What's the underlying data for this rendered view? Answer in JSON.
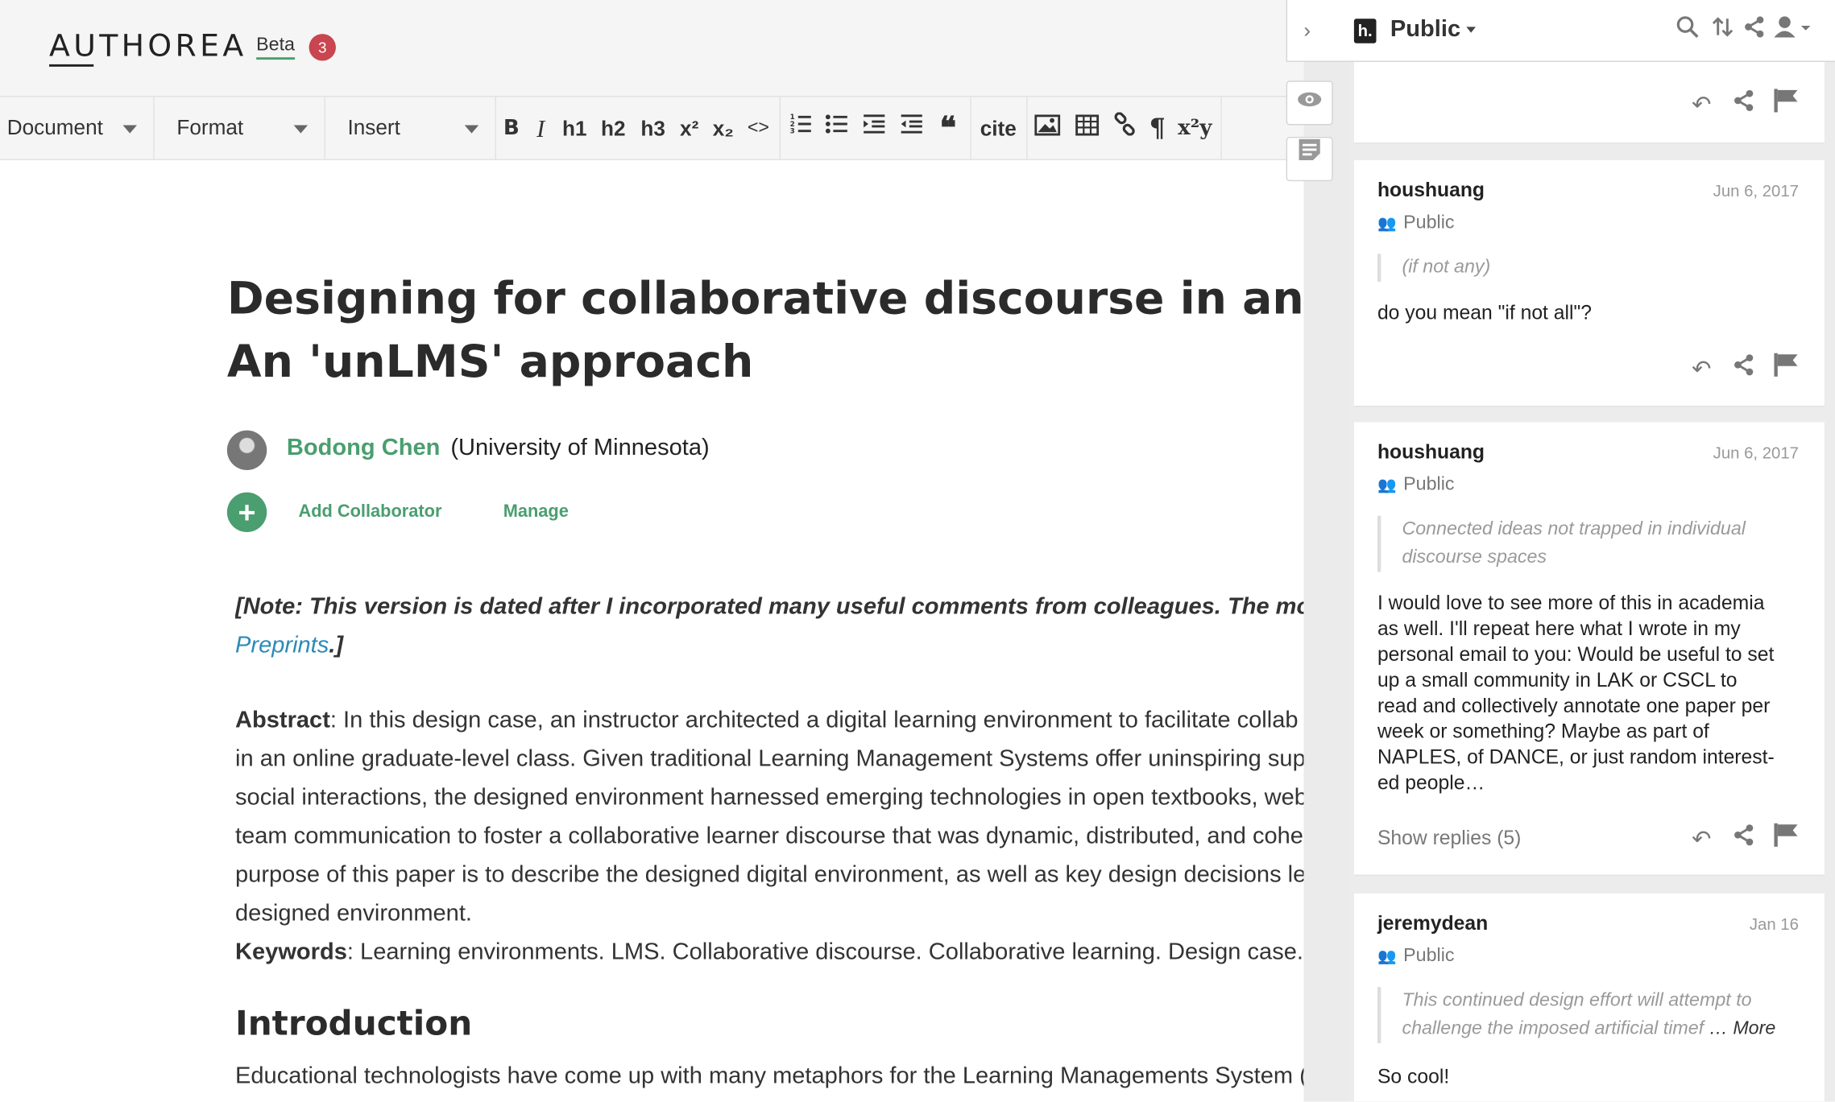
{
  "app": {
    "logo": "AUTHOREA",
    "beta": "Beta",
    "badge": "3"
  },
  "toolbar": {
    "menus": [
      "Document",
      "Format",
      "Insert"
    ],
    "buttons": [
      "B",
      "I",
      "h1",
      "h2",
      "h3",
      "x²",
      "x₂",
      "<>",
      "ordered-list",
      "bullet-list",
      "indent",
      "outdent",
      "quote",
      "cite",
      "image",
      "table",
      "link",
      "pilcrow",
      "x²y"
    ]
  },
  "document": {
    "title_line1": "Designing for collaborative discourse in an online",
    "title_line2": "An 'unLMS' approach",
    "author": "Bodong Chen",
    "affiliation": "(University of Minnesota)",
    "add_collaborator": "Add Collaborator",
    "manage": "Manage",
    "note_text": "[Note: This version is dated after I incorporated many useful comments from colleagues. The most recent v",
    "note_link": "Preprints",
    "note_end": ".]",
    "abstract_label": "Abstract",
    "abstract_lines": [
      ": In this design case, an instructor architected a digital learning environment to facilitate collab",
      "in an online graduate-level class. Given traditional Learning Management Systems offer uninspiring sup",
      "social interactions, the designed environment harnessed emerging technologies in open textbooks, web",
      "team communication to foster a collaborative learner discourse that was dynamic, distributed, and cohe",
      "purpose of this paper is to describe the designed digital environment, as well as key design decisions lea",
      "designed environment."
    ],
    "keywords_label": "Keywords",
    "keywords_text": ": Learning environments. LMS. Collaborative discourse. Collaborative learning. Design case.",
    "intro_heading": "Introduction",
    "intro_text": "Educational technologists have come up with many metaphors for the Learning Managements System ("
  },
  "hypothesis": {
    "group": "Public",
    "annotations": [
      {
        "user": "houshuang",
        "date": "Jun 6, 2017",
        "visibility": "Public",
        "quote": "(if not any)",
        "text": "do you mean \"if not all\"?"
      },
      {
        "user": "houshuang",
        "date": "Jun 6, 2017",
        "visibility": "Public",
        "quote_lines": [
          "Connected ideas not trapped in individual",
          "discourse spaces"
        ],
        "text_lines": [
          "I would love to see more of this in academia",
          "as well. I'll repeat here what I wrote in my",
          "personal email to you: Would be useful to set",
          "up a small community in LAK or CSCL to",
          "read and collectively annotate one paper per",
          "week or something? Maybe as part of",
          "NAPLES, of DANCE, or just random interest-",
          "ed people…"
        ],
        "show_replies": "Show replies (5)"
      },
      {
        "user": "jeremydean",
        "date": "Jan 16",
        "visibility": "Public",
        "quote_lines": [
          "This continued design effort will attempt to",
          "challenge the imposed artificial timef"
        ],
        "more": "… More",
        "text": "So cool!"
      }
    ]
  },
  "colors": {
    "accent": "#4a9e6f",
    "badge": "#c9454f",
    "link": "#2b8ab8"
  }
}
